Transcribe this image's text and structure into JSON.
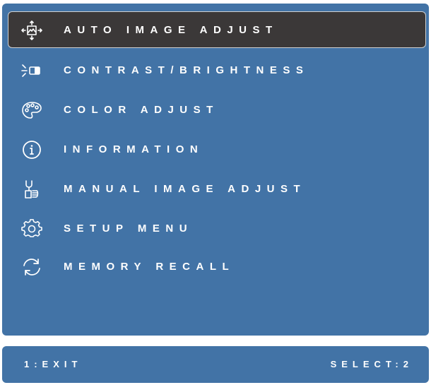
{
  "menu": {
    "items": [
      {
        "label": "AUTO IMAGE ADJUST",
        "icon": "auto-adjust-icon",
        "selected": true
      },
      {
        "label": "CONTRAST/BRIGHTNESS",
        "icon": "contrast-brightness-icon",
        "selected": false
      },
      {
        "label": "COLOR ADJUST",
        "icon": "palette-icon",
        "selected": false
      },
      {
        "label": "INFORMATION",
        "icon": "info-icon",
        "selected": false
      },
      {
        "label": "MANUAL IMAGE ADJUST",
        "icon": "manual-adjust-icon",
        "selected": false
      },
      {
        "label": "SETUP MENU",
        "icon": "gear-icon",
        "selected": false
      },
      {
        "label": "MEMORY RECALL",
        "icon": "refresh-icon",
        "selected": false
      }
    ]
  },
  "status": {
    "exit_label": "1:EXIT",
    "select_label": "SELECT:2"
  },
  "colors": {
    "panel_background": "#4273a6",
    "selected_background": "#3b3838",
    "text": "#ffffff"
  }
}
